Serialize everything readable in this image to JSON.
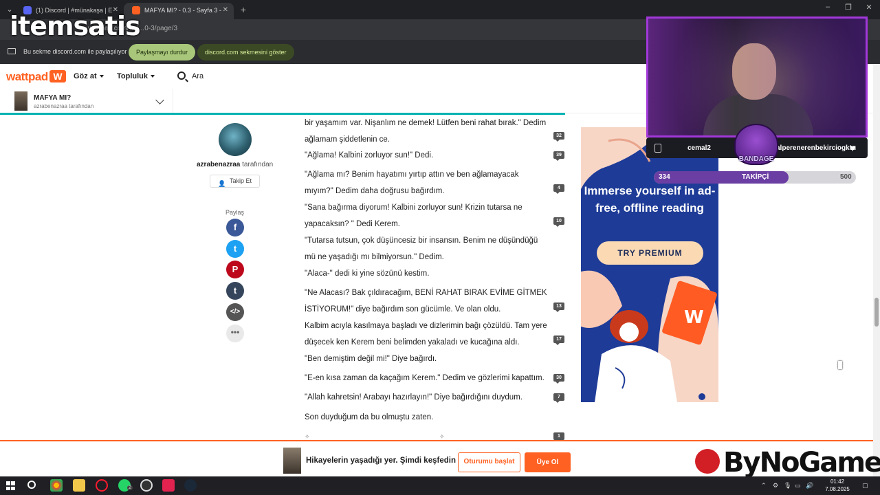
{
  "browser": {
    "tabs": [
      {
        "label": "(1) Discord | #münakaşa | E"
      },
      {
        "label": "MAFYA MI? - 0.3 - Sayfa 3 -"
      }
    ],
    "address": "wattpad.com/…/…0-3/page/3",
    "share_notice": "Bu sekme discord.com ile paylaşılıyor",
    "stop_sharing": "Paylaşmayı durdur",
    "show_tab": "discord.com sekmesini göster"
  },
  "overlay": {
    "itemsatis_logo": "itemsatis",
    "streamer_left": "cemal2",
    "streamer_right": "alperenerenbekirciogktu",
    "badge": "BANDAGE",
    "followers_current": "334",
    "followers_label": "TAKİPÇİ",
    "followers_goal": "500",
    "followers_progress": 0.668,
    "sponsor": "ByNoGame"
  },
  "wattpad": {
    "logo": "wattpad",
    "nav": {
      "browse": "Göz at",
      "community": "Topluluk",
      "search": "Ara"
    },
    "story": {
      "title": "MAFYA MI?",
      "author_line": "azrabenazraa tarafından"
    },
    "author": {
      "name": "azrabenazraa",
      "suffix": " tarafından",
      "follow": "Takip Et"
    },
    "share": {
      "label": "Paylaş"
    }
  },
  "paragraphs": [
    {
      "text": "bir yaşamım var. Nişanlım ne demek! Lütfen beni rahat bırak.\" Dedim ağlamam şiddetlenin ce.",
      "comments": "32"
    },
    {
      "text": "\"Ağlama! Kalbini zorluyor sun!\" Dedi.",
      "comments": "39"
    },
    {
      "text": "\"Ağlama mı? Benim hayatımı yırtıp attın ve ben ağlamayacak mıyım?\" Dedim daha doğrusu bağırdım.",
      "comments": "4"
    },
    {
      "text": "\"Sana bağırma diyorum! Kalbini zorluyor sun! Krizin tutarsa ne yapacaksın? \" Dedi Kerem.",
      "comments": "10"
    },
    {
      "text": "\"Tutarsa tutsun, çok düşüncesiz bir insansın. Benim ne düşündüğü mü ne yaşadığı mı bilmiyorsun.\" Dedim.",
      "comments": ""
    },
    {
      "text": "\"Alaca-\" dedi ki yine sözünü kestim.",
      "comments": ""
    },
    {
      "text": "\"Ne Alacası?  Bak çıldıracağım, BENİ RAHAT BIRAK EVİME GİTMEK İSTİYORUM!\" diye bağırdım son gücümle. Ve olan oldu.",
      "comments": "13"
    },
    {
      "text": "Kalbim acıyla kasılmaya başladı ve dizlerimin bağı çözüldü. Tam yere düşecek ken Kerem beni belimden yakaladı ve kucağına aldı.",
      "comments": "17"
    },
    {
      "text": "\"Ben demiştim değil mi!\" Diye bağırdı.",
      "comments": ""
    },
    {
      "text": "\"E-en kısa zaman da kaçağım Kerem.\" Dedim ve gözlerimi kapattım.",
      "comments": "30"
    },
    {
      "text": "\"Allah kahretsin! Arabayı hazırlayın!\" Diye bağırdığını duydum.",
      "comments": "7"
    },
    {
      "text": "Son duyduğum da bu olmuştu zaten.",
      "comments": ""
    }
  ],
  "separator_comments": "1",
  "ad": {
    "headline": "Immerse yourself in ad-free, offline reading",
    "cta": "TRY PREMIUM"
  },
  "bottom_banner": {
    "text": "Hikayelerin yaşadığı yer. Şimdi keşfedin",
    "start": "Oturumu başlat",
    "signup": "Üye Ol"
  },
  "taskbar": {
    "time": "01:42",
    "date": "7.08.2025",
    "whatsapp_badge": "2"
  }
}
